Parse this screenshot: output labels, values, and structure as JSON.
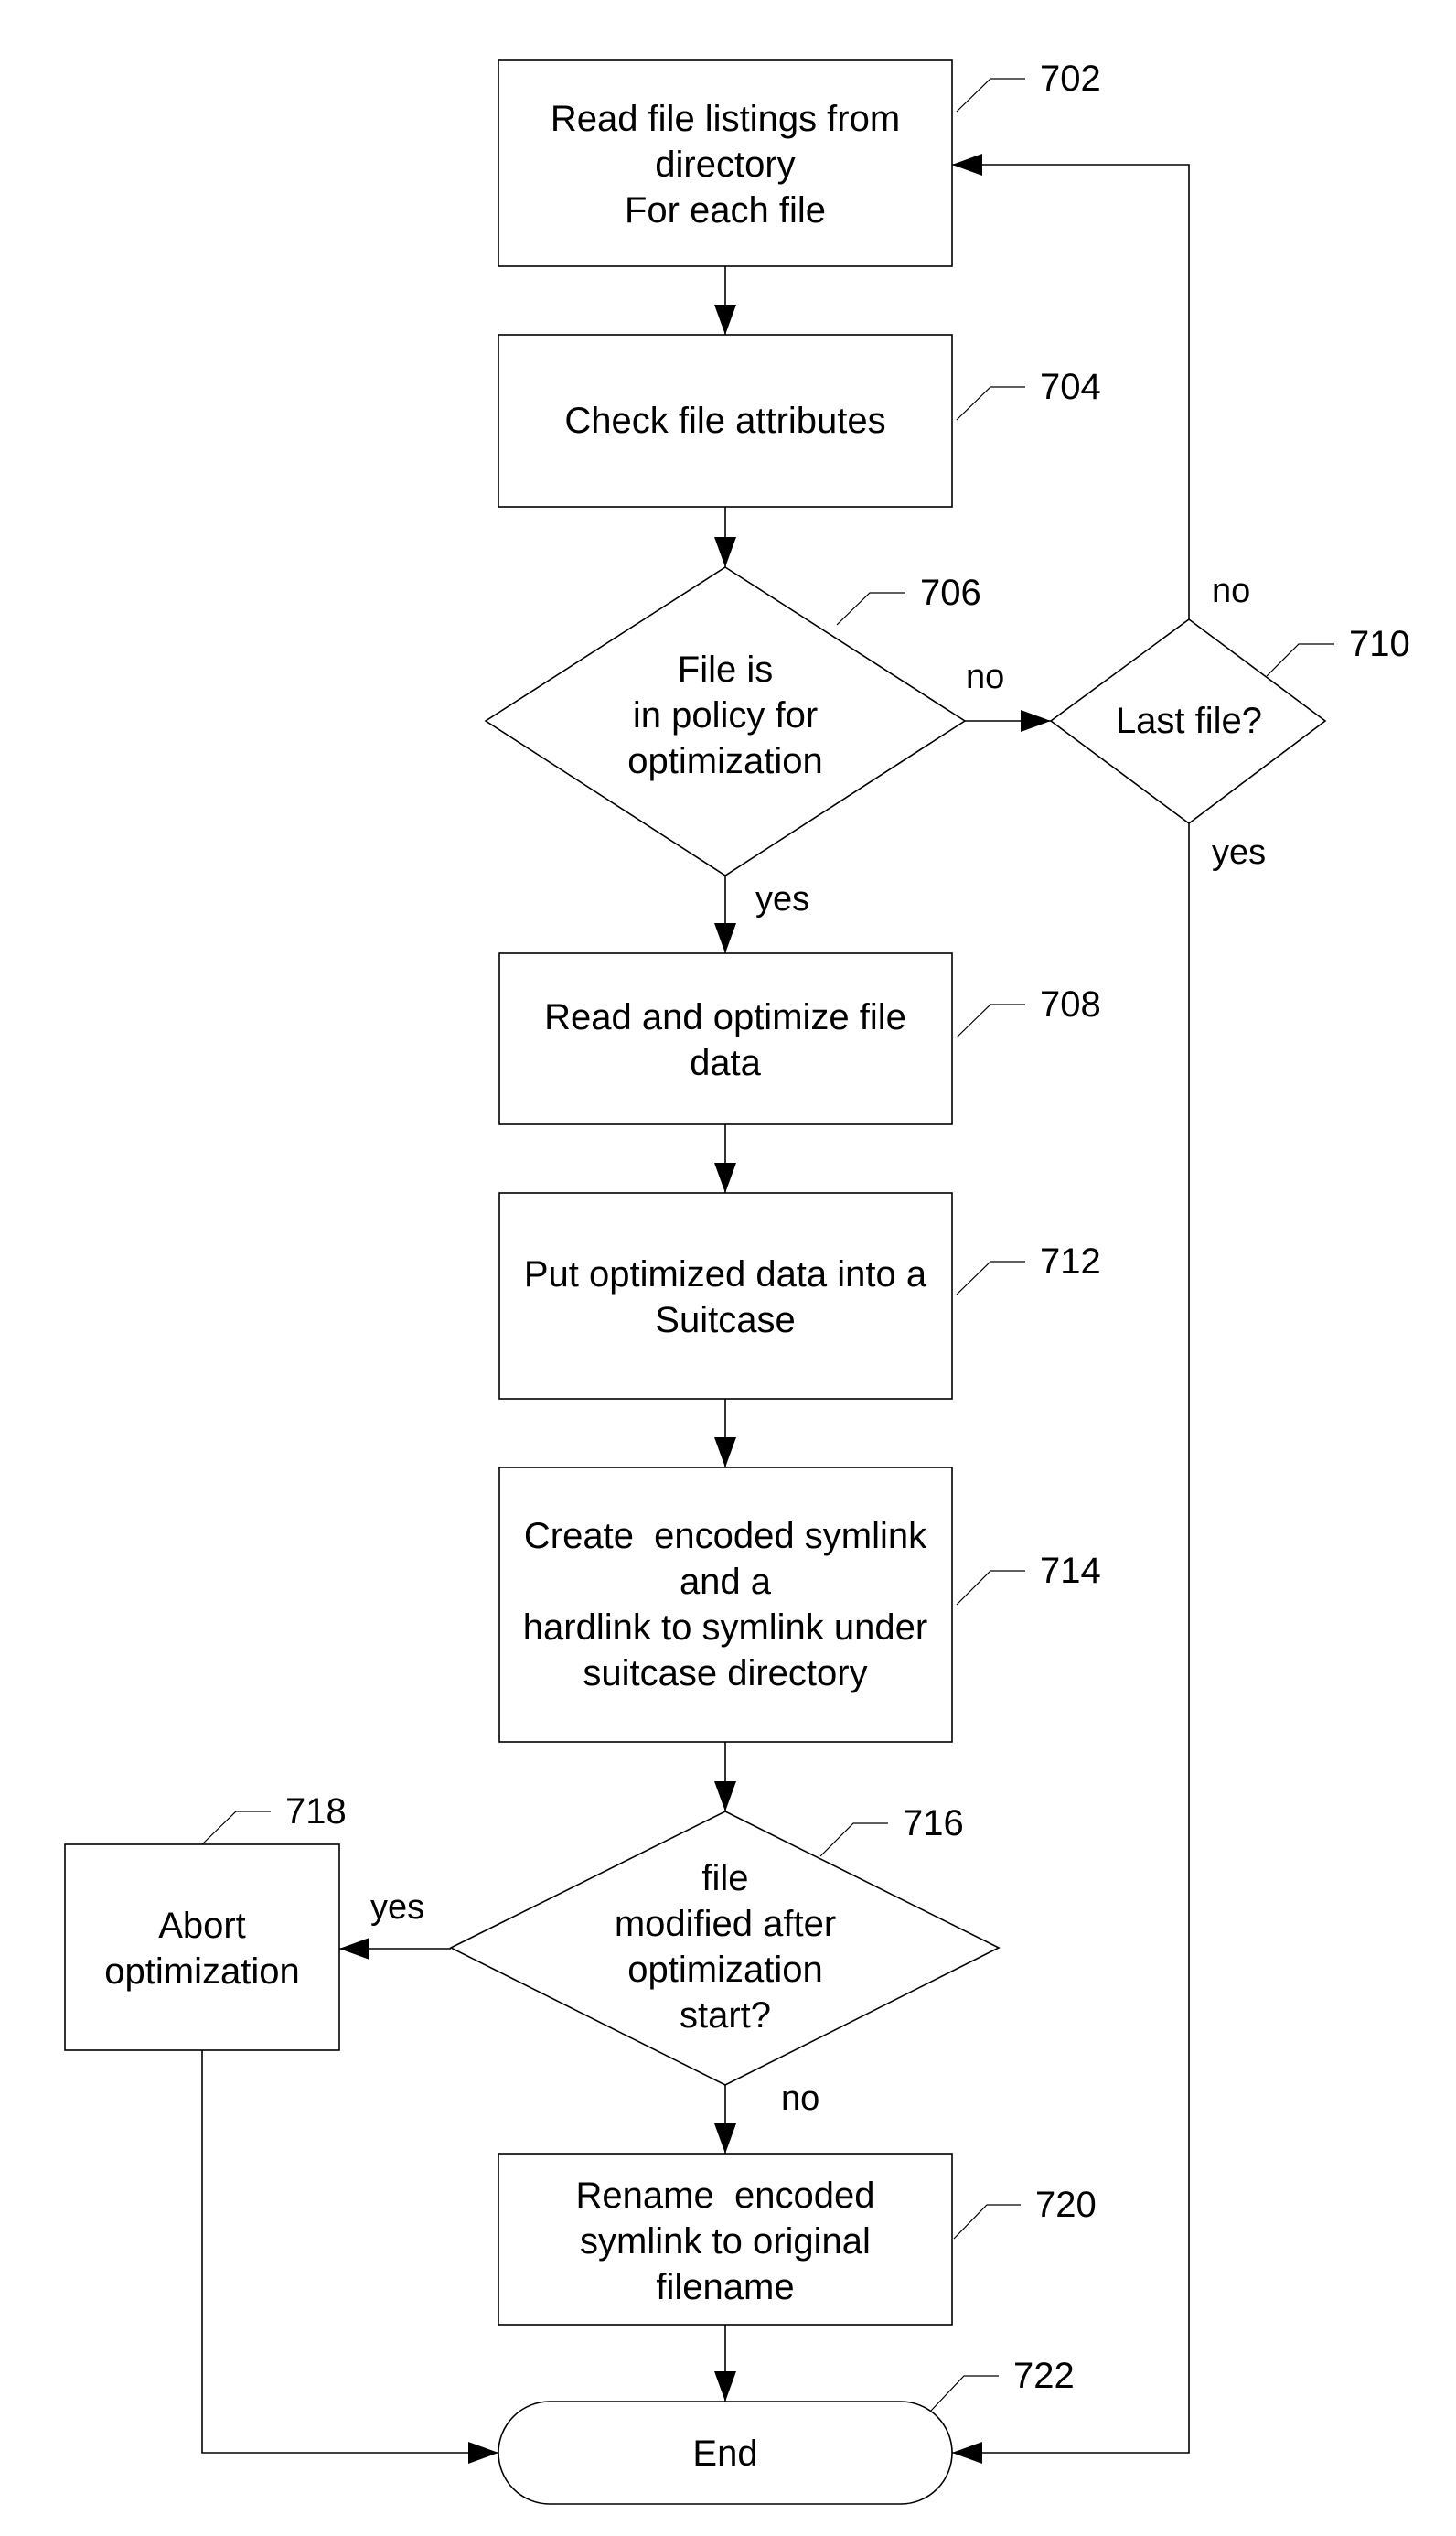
{
  "nodes": {
    "n702": {
      "ref": "702",
      "lines": [
        "Read file listings from",
        "directory",
        "For each file"
      ]
    },
    "n704": {
      "ref": "704",
      "lines": [
        "Check file attributes"
      ]
    },
    "n706": {
      "ref": "706",
      "lines": [
        "File is",
        "in policy for",
        "optimization"
      ]
    },
    "n708": {
      "ref": "708",
      "lines": [
        "Read and optimize file",
        "data"
      ]
    },
    "n710": {
      "ref": "710",
      "lines": [
        "Last file?"
      ]
    },
    "n712": {
      "ref": "712",
      "lines": [
        "Put optimized data into a",
        "Suitcase"
      ]
    },
    "n714": {
      "ref": "714",
      "lines": [
        "Create  encoded symlink",
        "and a",
        "hardlink to symlink under",
        "suitcase directory"
      ]
    },
    "n716": {
      "ref": "716",
      "lines": [
        "file",
        "modified after",
        "optimization",
        "start?"
      ]
    },
    "n718": {
      "ref": "718",
      "lines": [
        "Abort",
        "optimization"
      ]
    },
    "n720": {
      "ref": "720",
      "lines": [
        "Rename  encoded",
        "symlink to original",
        "filename"
      ]
    },
    "n722": {
      "ref": "722",
      "lines": [
        "End"
      ]
    }
  },
  "edges": {
    "e706_no": "no",
    "e706_yes": "yes",
    "e710_no": "no",
    "e710_yes": "yes",
    "e716_yes": "yes",
    "e716_no": "no"
  }
}
